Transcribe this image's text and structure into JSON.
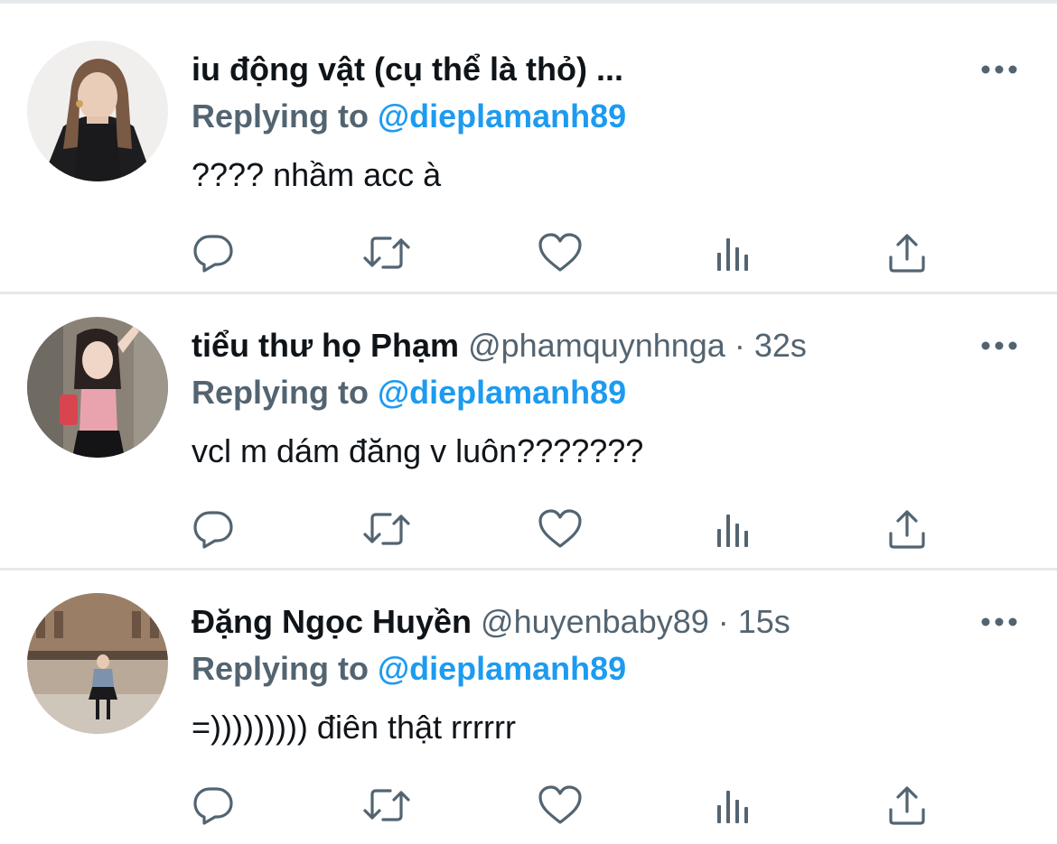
{
  "tweets": [
    {
      "name": "iu động vật (cụ thể là thỏ) ...",
      "handle_time": "",
      "reply_prefix": "Replying to",
      "reply_to": "@dieplamanh89",
      "text": "???? nhầm acc à"
    },
    {
      "name": "tiểu thư họ Phạm",
      "handle_time": "@phamquynhnga · 32s",
      "reply_prefix": "Replying to",
      "reply_to": "@dieplamanh89",
      "text": "vcl m dám đăng v luôn???????"
    },
    {
      "name": "Đặng Ngọc Huyền",
      "handle_time": "@huyenbaby89 · 15s",
      "reply_prefix": "Replying to",
      "reply_to": "@dieplamanh89",
      "text": "=))))))))) điên thật rrrrrr"
    }
  ],
  "icons": {
    "more": "more-icon",
    "reply": "reply-icon",
    "retweet": "retweet-icon",
    "like": "heart-icon",
    "stats": "stats-icon",
    "share": "share-icon"
  },
  "colors": {
    "name": "#0f1419",
    "secondary": "#536471",
    "mention": "#1d9bf0",
    "divider": "#e6e9eb"
  }
}
